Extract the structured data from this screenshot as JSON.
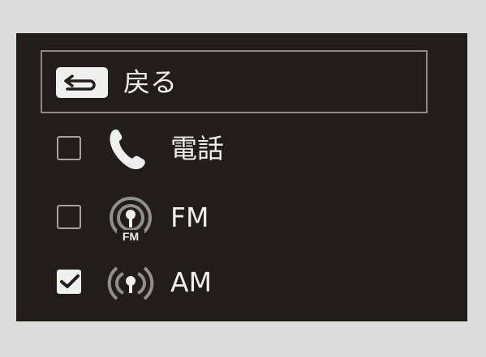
{
  "menu": {
    "back": {
      "label": "戻る",
      "icon": "back-arrow-icon"
    },
    "items": [
      {
        "id": "phone",
        "label": "電話",
        "icon": "phone-icon",
        "checked": false
      },
      {
        "id": "fm",
        "label": "FM",
        "icon": "fm-radio-icon",
        "icon_text": "FM",
        "checked": false
      },
      {
        "id": "am",
        "label": "AM",
        "icon": "am-radio-icon",
        "checked": true
      }
    ]
  },
  "colors": {
    "background": "#dbdcdb",
    "panel": "#221c1b",
    "text": "#efefef",
    "icon_gray": "#8f8f8f",
    "border": "#8c8b8a"
  }
}
